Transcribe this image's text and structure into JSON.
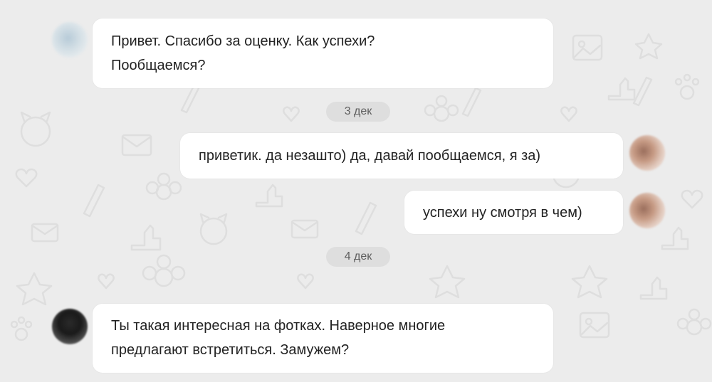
{
  "messages": [
    {
      "lines": [
        "Привет. Спасибо за оценку. Как успехи?",
        "Пообщаемся?"
      ]
    },
    {
      "lines": [
        "приветик. да незашто) да, давай пообщаемся, я за)"
      ]
    },
    {
      "lines": [
        "успехи ну смотря в чем)"
      ]
    },
    {
      "lines": [
        "Ты такая интересная на фотках. Наверное многие",
        "предлагают встретиться. Замужем?"
      ]
    }
  ],
  "dates": [
    "3 дек",
    "4 дек"
  ],
  "colors": {
    "background": "#ececec",
    "bubble": "#ffffff",
    "date_chip": "#dedede"
  }
}
